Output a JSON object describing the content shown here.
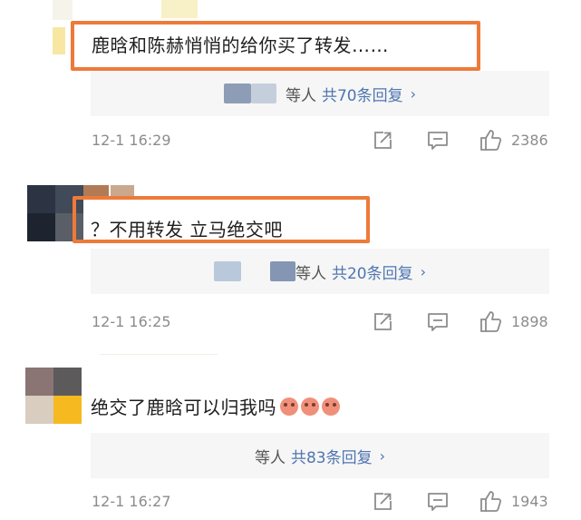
{
  "comments": [
    {
      "text": "鹿晗和陈赫悄悄的给你买了转发……",
      "reply_prefix": "等人",
      "reply_count": "共70条回复",
      "chevron": "›",
      "time": "12-1 16:29",
      "likes": "2386"
    },
    {
      "text": "？不用转发 立马绝交吧",
      "reply_prefix": "等人",
      "reply_count": "共20条回复",
      "chevron": "›",
      "time": "12-1 16:25",
      "likes": "1898"
    },
    {
      "text": "绝交了鹿晗可以归我吗",
      "reply_prefix": "等人",
      "reply_count": "共83条回复",
      "chevron": "›",
      "time": "12-1 16:27",
      "likes": "1943"
    }
  ],
  "icons": {
    "share": "share-icon",
    "comment": "comment-icon",
    "like": "thumbs-up-icon",
    "emoji": "crying-face-emoji"
  },
  "colors": {
    "highlight": "#ee7a3a",
    "link": "#4f76b0",
    "meta": "#8c8c8c",
    "reply_bg": "#f6f6f6"
  }
}
